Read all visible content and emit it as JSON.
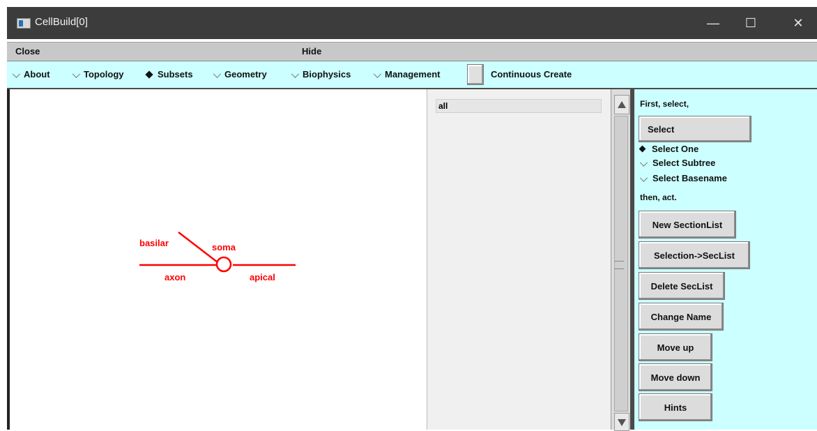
{
  "window": {
    "title": "CellBuild[0]",
    "controls": {
      "minimize": "—",
      "maximize": "☐",
      "close": "✕"
    }
  },
  "menubar": {
    "close": "Close",
    "hide": "Hide"
  },
  "toolbar": {
    "items": [
      {
        "label": "About",
        "selected": false
      },
      {
        "label": "Topology",
        "selected": false
      },
      {
        "label": "Subsets",
        "selected": true
      },
      {
        "label": "Geometry",
        "selected": false
      },
      {
        "label": "Biophysics",
        "selected": false
      },
      {
        "label": "Management",
        "selected": false
      }
    ],
    "continuous_create": {
      "label": "Continuous Create",
      "checked": false
    }
  },
  "topology": {
    "labels": {
      "basilar": "basilar",
      "soma": "soma",
      "axon": "axon",
      "apical": "apical"
    },
    "color": "#ff0000"
  },
  "subset_list": {
    "items": [
      "all"
    ]
  },
  "controls": {
    "first_select": "First, select,",
    "select_button": "Select",
    "modes": [
      {
        "label": "Select One",
        "selected": true
      },
      {
        "label": "Select Subtree",
        "selected": false
      },
      {
        "label": "Select Basename",
        "selected": false
      }
    ],
    "then_act": "then, act.",
    "buttons": {
      "new_sectionlist": "New SectionList",
      "selection_to_seclist": "Selection->SecList",
      "delete_seclist": "Delete SecList",
      "change_name": "Change Name",
      "move_up": "Move up",
      "move_down": "Move down",
      "hints": "Hints"
    }
  },
  "colors": {
    "toolbar_bg": "#ccffff",
    "titlebar_bg": "#3c3c3c",
    "menubar_bg": "#c8c8c8"
  }
}
